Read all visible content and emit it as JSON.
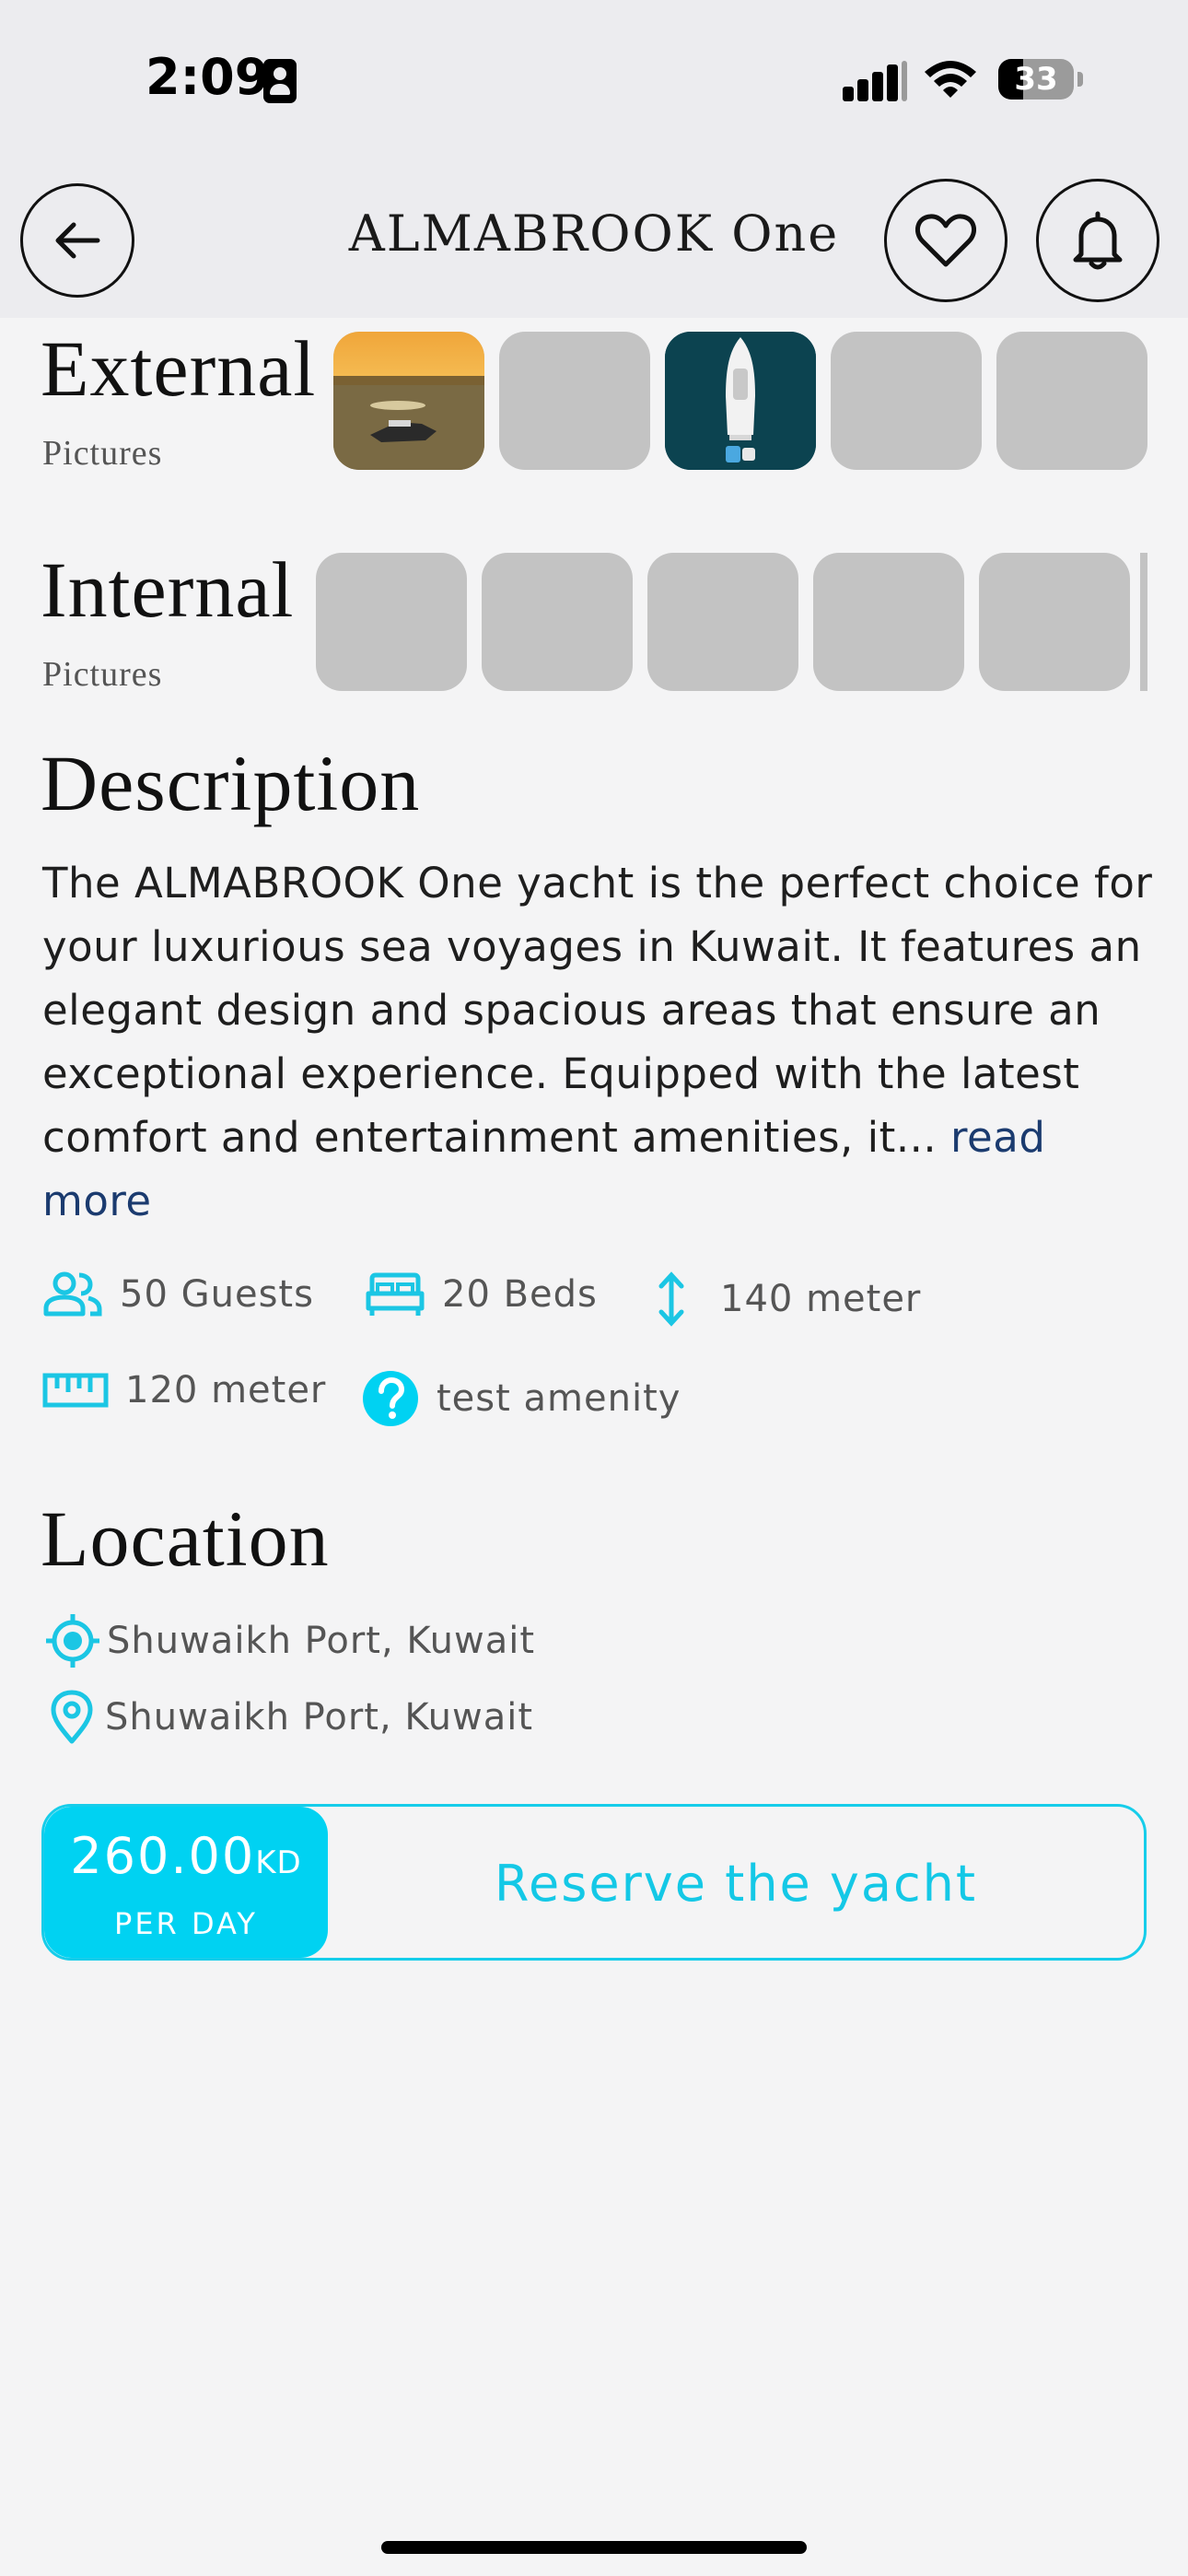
{
  "status_bar": {
    "time": "2:09",
    "battery": "33"
  },
  "header": {
    "title": "ALMABROOK One",
    "back_icon": "arrow-left-icon",
    "favorite_icon": "heart-icon",
    "notification_icon": "bell-icon"
  },
  "external": {
    "title": "External",
    "subtitle": "Pictures",
    "thumbnails": [
      "sunset-yacht-photo",
      "placeholder",
      "aerial-yacht-photo",
      "placeholder",
      "placeholder"
    ]
  },
  "internal": {
    "title": "Internal",
    "subtitle": "Pictures",
    "thumbnails": [
      "placeholder",
      "placeholder",
      "placeholder",
      "placeholder",
      "placeholder"
    ]
  },
  "description": {
    "title": "Description",
    "text": "The ALMABROOK One yacht is the perfect choice for your luxurious sea voyages in Kuwait. It features an elegant design and spacious areas that ensure an exceptional experience. Equipped with the latest comfort and entertainment amenities, it...",
    "read_more": "read more"
  },
  "amenities": [
    {
      "icon": "guests-icon",
      "label": "50 Guests"
    },
    {
      "icon": "bed-icon",
      "label": "20 Beds"
    },
    {
      "icon": "height-icon",
      "label": "140 meter"
    },
    {
      "icon": "ruler-icon",
      "label": "120 meter"
    },
    {
      "icon": "question-icon",
      "label": "test amenity"
    }
  ],
  "location": {
    "title": "Location",
    "items": [
      {
        "icon": "gps-target-icon",
        "label": "Shuwaikh Port, Kuwait"
      },
      {
        "icon": "map-pin-icon",
        "label": "Shuwaikh Port, Kuwait"
      }
    ]
  },
  "reserve": {
    "price": "260.00",
    "currency": "KD",
    "unit": "PER DAY",
    "label": "Reserve the yacht"
  },
  "colors": {
    "accent": "#00d2f2",
    "background": "#f4f4f5",
    "header_bg": "#ececef",
    "link": "#1b3b6f",
    "placeholder": "#c3c3c3"
  }
}
